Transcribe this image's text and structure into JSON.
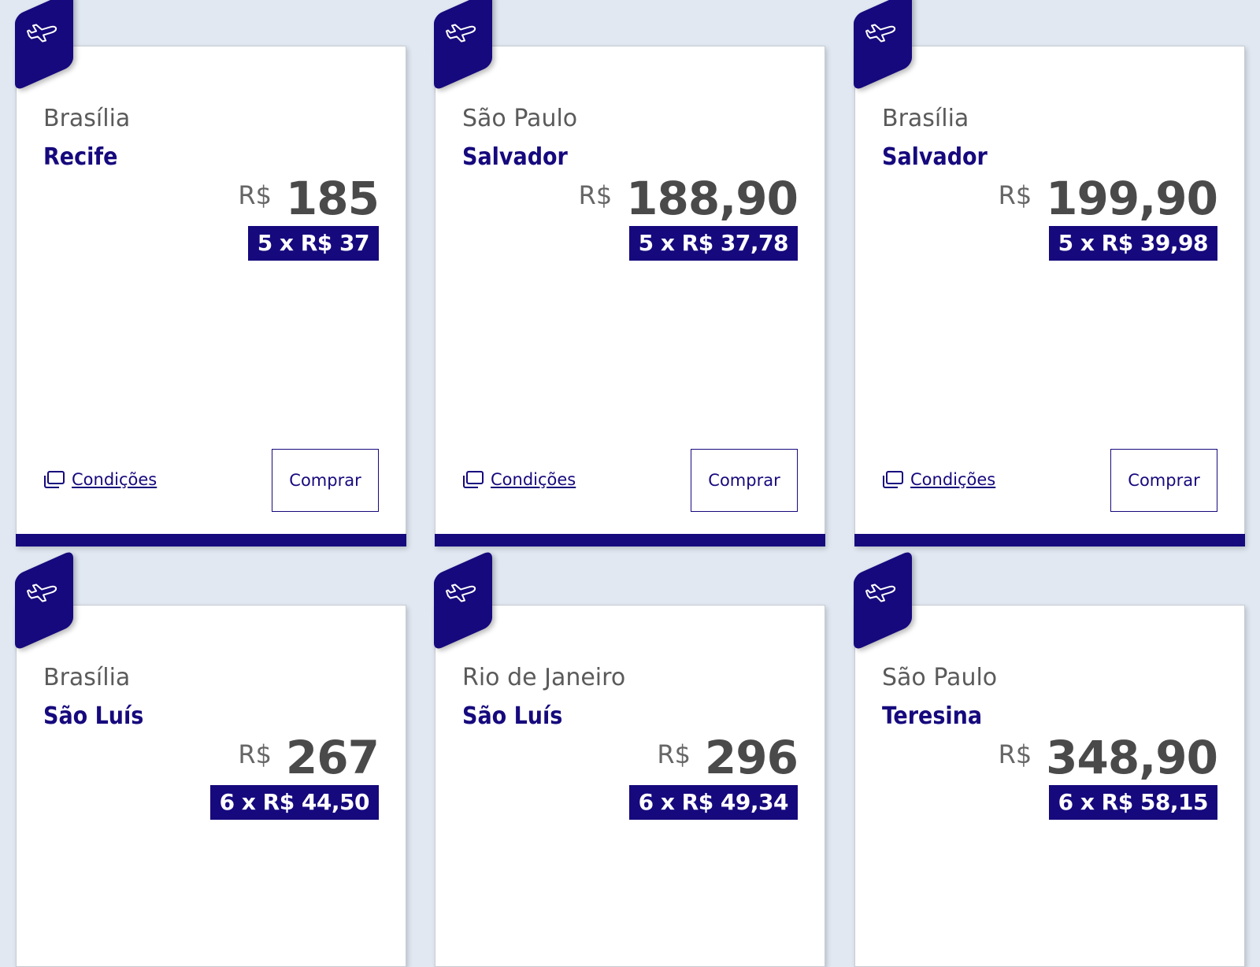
{
  "cards": [
    {
      "origin": "Brasília",
      "destination": "Recife",
      "currency": "R$",
      "price": "185",
      "installment": "5 x R$ 37",
      "conditions_label": "Condições",
      "buy_label": "Comprar"
    },
    {
      "origin": "São Paulo",
      "destination": "Salvador",
      "currency": "R$",
      "price": "188,90",
      "installment": "5 x R$ 37,78",
      "conditions_label": "Condições",
      "buy_label": "Comprar"
    },
    {
      "origin": "Brasília",
      "destination": "Salvador",
      "currency": "R$",
      "price": "199,90",
      "installment": "5 x R$ 39,98",
      "conditions_label": "Condições",
      "buy_label": "Comprar"
    },
    {
      "origin": "Brasília",
      "destination": "São Luís",
      "currency": "R$",
      "price": "267",
      "installment": "6 x R$ 44,50"
    },
    {
      "origin": "Rio de Janeiro",
      "destination": "São Luís",
      "currency": "R$",
      "price": "296",
      "installment": "6 x R$ 49,34"
    },
    {
      "origin": "São Paulo",
      "destination": "Teresina",
      "currency": "R$",
      "price": "348,90",
      "installment": "6 x R$ 58,15"
    }
  ],
  "icons": {
    "badge": "airplane-icon",
    "conditions": "copy-icon"
  },
  "colors": {
    "brand": "#16097d",
    "background": "#e1e8f2",
    "price_text": "#4a4a4a"
  }
}
